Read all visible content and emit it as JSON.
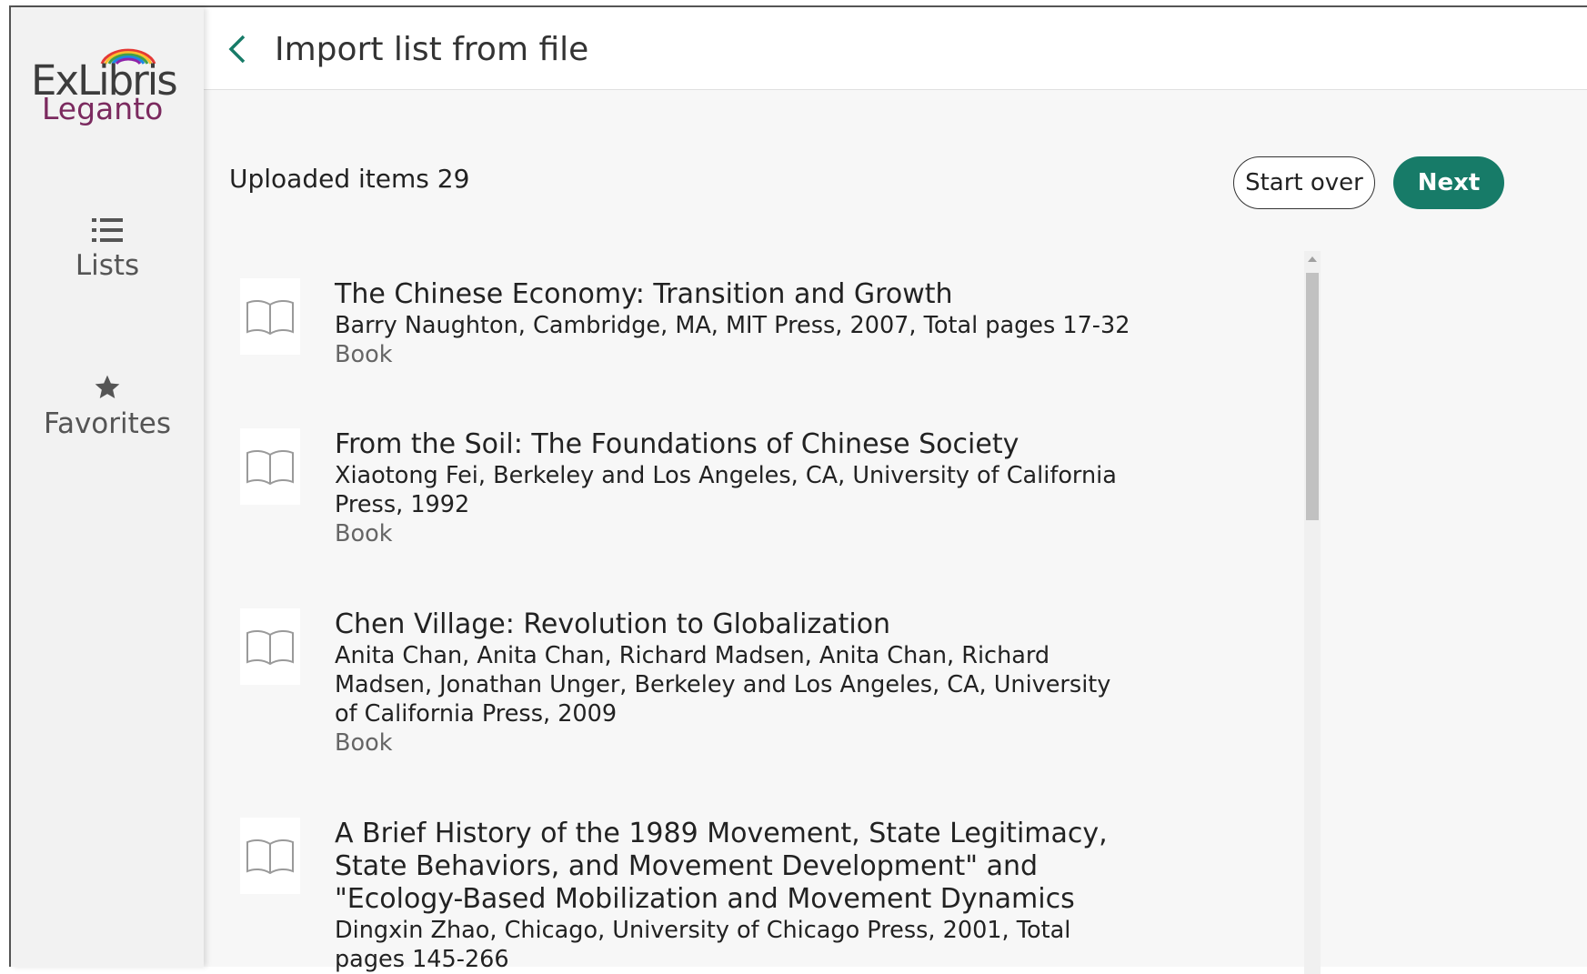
{
  "app": {
    "logo_text": "ExLibris",
    "logo_subtext": "Leganto"
  },
  "sidebar": {
    "items": [
      {
        "label": "Lists",
        "icon": "list-icon"
      },
      {
        "label": "Favorites",
        "icon": "star-icon"
      }
    ]
  },
  "header": {
    "title": "Import list from file",
    "back_icon": "chevron-left-icon"
  },
  "toolbar": {
    "uploaded_label": "Uploaded items 29",
    "start_over_label": "Start over",
    "next_label": "Next"
  },
  "colors": {
    "accent": "#177b68",
    "brand_purple": "#7b2a5f"
  },
  "items": [
    {
      "title": "The Chinese Economy: Transition and Growth",
      "meta": "Barry Naughton, Cambridge, MA, MIT Press, 2007, Total pages 17-32",
      "type": "Book",
      "icon": "book-icon"
    },
    {
      "title": "From the Soil: The Foundations of Chinese Society",
      "meta": "Xiaotong Fei, Berkeley and Los Angeles, CA, University of California Press, 1992",
      "type": "Book",
      "icon": "book-icon"
    },
    {
      "title": "Chen Village: Revolution to Globalization",
      "meta": "Anita Chan, Anita Chan, Richard Madsen, Anita Chan, Richard Madsen, Jonathan Unger, Berkeley and Los Angeles, CA, University of California Press, 2009",
      "type": "Book",
      "icon": "book-icon"
    },
    {
      "title": "A Brief History of the 1989 Movement, State Legitimacy, State Behaviors, and Movement Development\" and \"Ecology-Based Mobilization and Movement Dynamics",
      "meta": "Dingxin Zhao, Chicago, University of Chicago Press, 2001, Total pages 145-266",
      "type": "",
      "icon": "book-icon"
    }
  ]
}
